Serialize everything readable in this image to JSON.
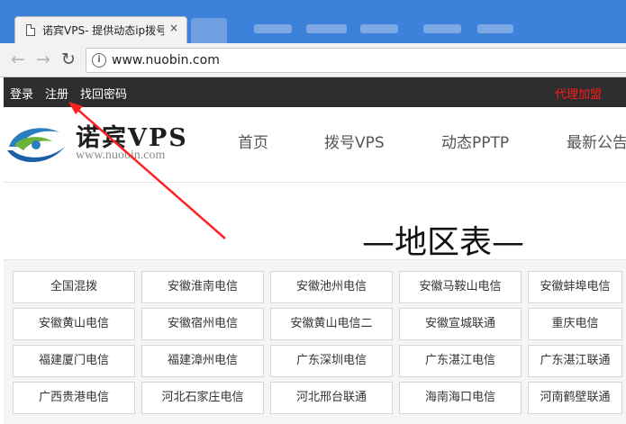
{
  "browser": {
    "tab_title": "诺宾VPS- 提供动态ip拨号",
    "tab_close": "×",
    "url": "www.nuobin.com",
    "icons": [
      "document-icon",
      "back-icon",
      "forward-icon",
      "reload-icon",
      "info-icon"
    ]
  },
  "topbar": {
    "login": "登录",
    "register": "注册",
    "recover": "找回密码",
    "join": "代理加盟",
    "join_color": "#ff1a1a"
  },
  "header": {
    "logo_cn": "诺宾VPS",
    "logo_domain": "www.nuobin.com",
    "nav": [
      "首页",
      "拨号VPS",
      "动态PPTP",
      "最新公告"
    ]
  },
  "page_title": "—地区表—",
  "regions": [
    [
      "全国混拨",
      "安徽淮南电信",
      "安徽池州电信",
      "安徽马鞍山电信",
      "安徽蚌埠电信"
    ],
    [
      "安徽黄山电信",
      "安徽宿州电信",
      "安徽黄山电信二",
      "安徽宣城联通",
      "重庆电信"
    ],
    [
      "福建厦门电信",
      "福建漳州电信",
      "广东深圳电信",
      "广东湛江电信",
      "广东湛江联通"
    ],
    [
      "广西贵港电信",
      "河北石家庄电信",
      "河北邢台联通",
      "海南海口电信",
      "河南鹤壁联通"
    ]
  ]
}
